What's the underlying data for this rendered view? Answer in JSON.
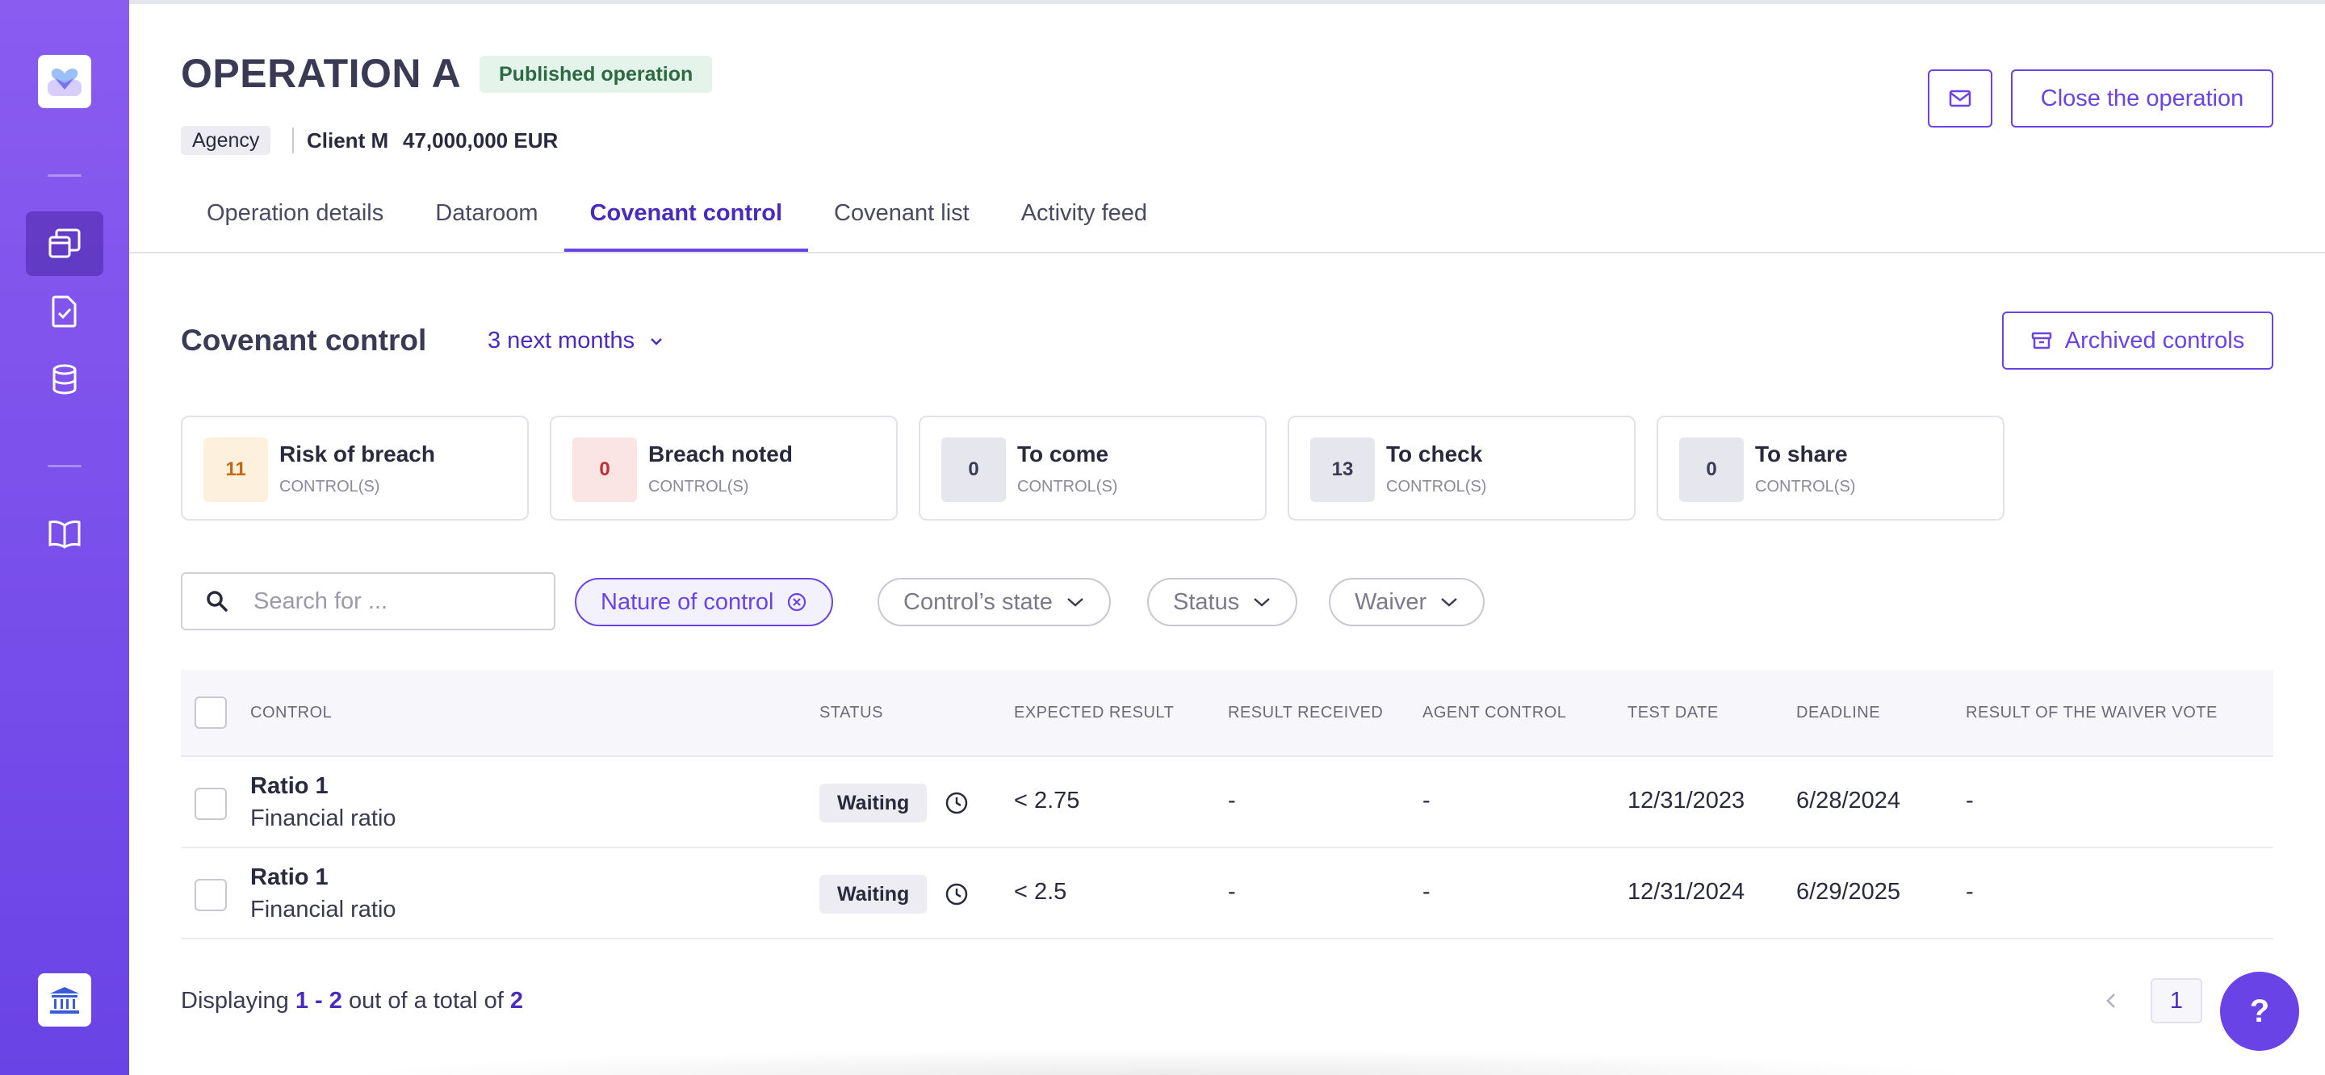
{
  "operation": {
    "title": "OPERATION A",
    "badge": "Published operation",
    "agency": "Agency",
    "client": "Client M",
    "amount": "47,000,000 EUR",
    "close_button": "Close the operation"
  },
  "tabs": [
    {
      "label": "Operation details",
      "active": false
    },
    {
      "label": "Dataroom",
      "active": false
    },
    {
      "label": "Covenant control",
      "active": true
    },
    {
      "label": "Covenant list",
      "active": false
    },
    {
      "label": "Activity feed",
      "active": false
    }
  ],
  "section": {
    "title": "Covenant control",
    "period": "3 next months",
    "archived_button": "Archived controls"
  },
  "cards": [
    {
      "count": "11",
      "label": "Risk of breach",
      "sub": "CONTROL(S)",
      "bg": "#fdf0dc",
      "fg": "#c26a18"
    },
    {
      "count": "0",
      "label": "Breach noted",
      "sub": "CONTROL(S)",
      "bg": "#fbe4e4",
      "fg": "#c03030"
    },
    {
      "count": "0",
      "label": "To come",
      "sub": "CONTROL(S)",
      "bg": "#e6e6ee",
      "fg": "#3a3a55"
    },
    {
      "count": "13",
      "label": "To check",
      "sub": "CONTROL(S)",
      "bg": "#e6e6ee",
      "fg": "#3a3a55"
    },
    {
      "count": "0",
      "label": "To share",
      "sub": "CONTROL(S)",
      "bg": "#e6e6ee",
      "fg": "#3a3a55"
    }
  ],
  "filters": {
    "search_placeholder": "Search for ...",
    "nature": "Nature of control",
    "state": "Control’s state",
    "status": "Status",
    "waiver": "Waiver"
  },
  "table": {
    "headers": {
      "control": "CONTROL",
      "status": "STATUS",
      "expected": "EXPECTED RESULT",
      "received": "RESULT RECEIVED",
      "agent": "AGENT CONTROL",
      "test_date": "TEST DATE",
      "deadline": "DEADLINE",
      "waiver_vote": "RESULT OF THE WAIVER VOTE"
    },
    "rows": [
      {
        "name": "Ratio 1",
        "type": "Financial ratio",
        "status": "Waiting",
        "expected": "< 2.75",
        "received": "-",
        "agent": "-",
        "test_date": "12/31/2023",
        "deadline": "6/28/2024",
        "waiver_vote": "-"
      },
      {
        "name": "Ratio 1",
        "type": "Financial ratio",
        "status": "Waiting",
        "expected": "< 2.5",
        "received": "-",
        "agent": "-",
        "test_date": "12/31/2024",
        "deadline": "6/29/2025",
        "waiver_vote": "-"
      }
    ]
  },
  "footer": {
    "prefix": "Displaying",
    "range": "1 - 2",
    "middle": "out of a total of",
    "total": "2",
    "page": "1",
    "help": "?"
  },
  "colors": {
    "accent": "#6a43e6",
    "sidebar_top": "#8a5cf0",
    "sidebar_bottom": "#6a43e6"
  }
}
